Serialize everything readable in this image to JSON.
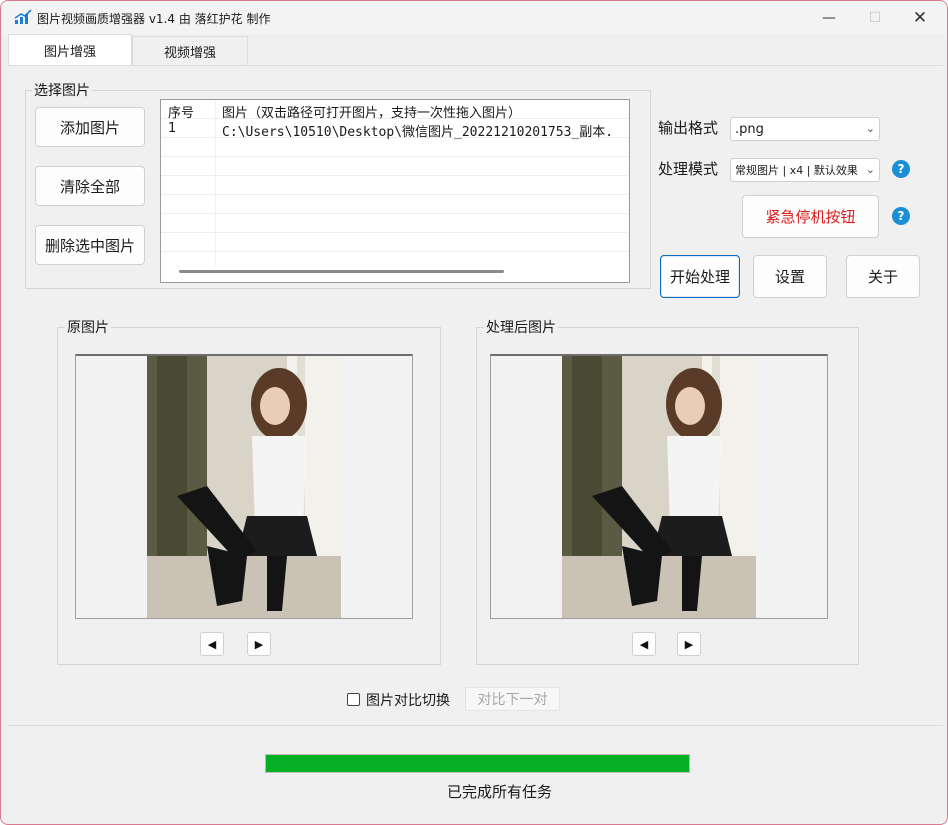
{
  "window": {
    "title": "图片视频画质增强器 v1.4    由 落红护花 制作",
    "controls": {
      "minimize": "—",
      "maximize": "☐",
      "close": "✕"
    }
  },
  "tabs": [
    {
      "label": "图片增强",
      "active": true
    },
    {
      "label": "视频增强",
      "active": false
    }
  ],
  "select_group": {
    "title": "选择图片",
    "buttons": {
      "add": "添加图片",
      "clear_all": "清除全部",
      "delete_selected": "删除选中图片"
    },
    "table": {
      "columns": [
        "序号",
        "图片（双击路径可打开图片，支持一次性拖入图片）"
      ],
      "rows": [
        [
          "1",
          "C:\\Users\\10510\\Desktop\\微信图片_20221210201753_副本."
        ]
      ]
    }
  },
  "settings": {
    "output_format_label": "输出格式",
    "output_format_value": ".png",
    "mode_label": "处理模式",
    "mode_value": "常规图片 | x4 | 默认效果",
    "emergency_stop": "紧急停机按钮",
    "help": "?"
  },
  "actions": {
    "start": "开始处理",
    "settings": "设置",
    "about": "关于"
  },
  "preview": {
    "original_title": "原图片",
    "processed_title": "处理后图片",
    "prev": "◀",
    "next": "▶"
  },
  "compare": {
    "checkbox_label": "图片对比切换",
    "checked": false,
    "next_pair": "对比下一对"
  },
  "progress": {
    "fraction": 1.0,
    "status": "已完成所有任务"
  },
  "colors": {
    "progress": "#06b025",
    "accent": "#0f6cbd",
    "danger": "#d81e1e",
    "help": "#1a8fd6"
  }
}
